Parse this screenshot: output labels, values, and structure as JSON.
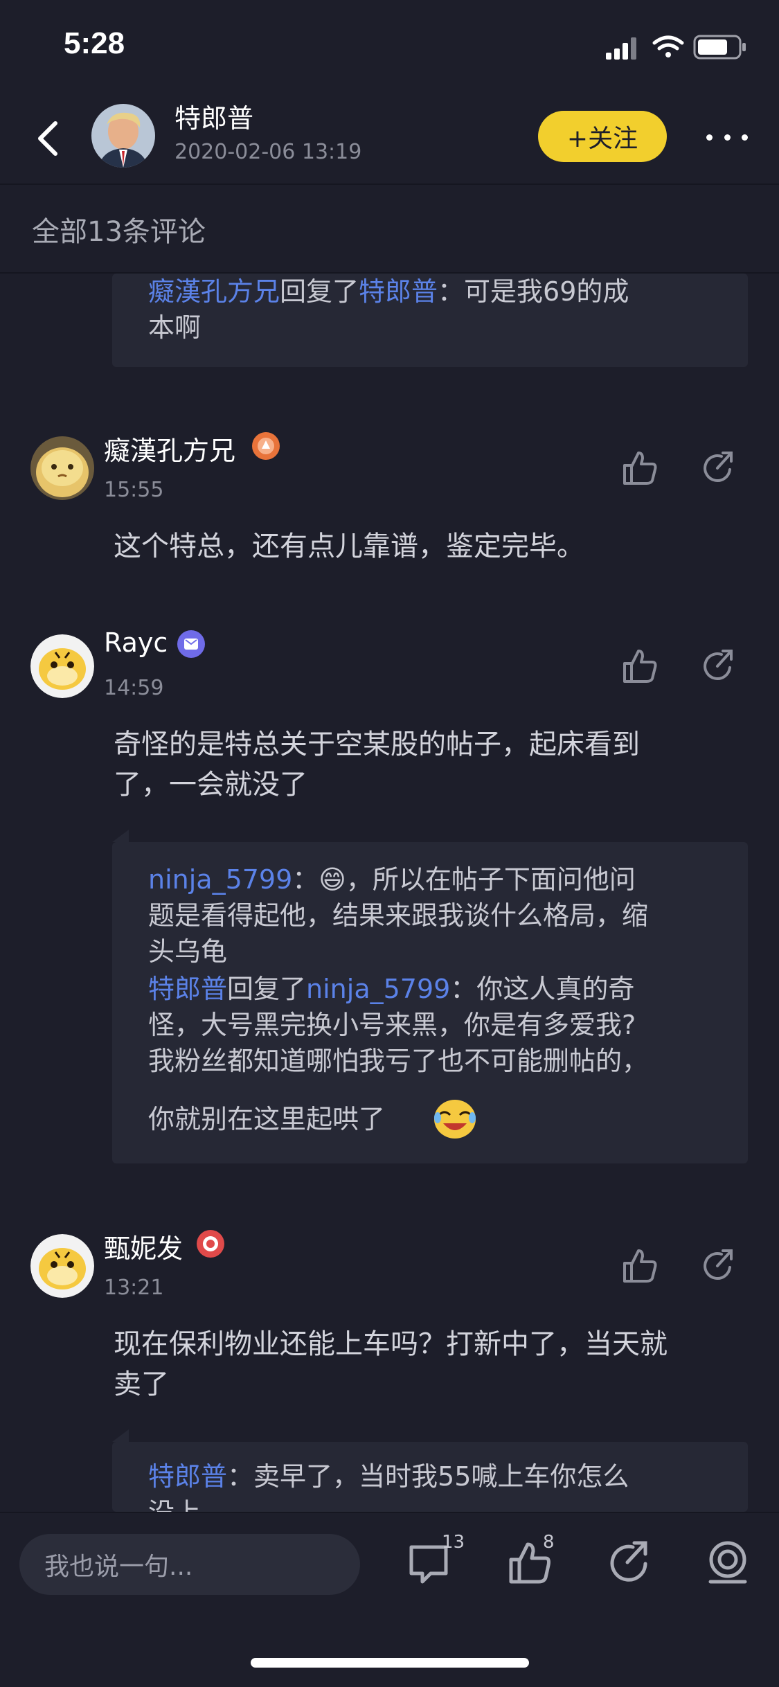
{
  "status_bar": {
    "time": "5:28"
  },
  "header": {
    "author_name": "特郎普",
    "post_time": "2020-02-06 13:19",
    "follow_label": "+关注"
  },
  "comments_count_label": "全部13条评论",
  "top_reply": {
    "user": "癡漢孔方兄",
    "action": "回复了",
    "target": "特郎普",
    "text": "：可是我69的成本啊",
    "line1": "：可是我69的成",
    "line2": "本啊"
  },
  "comments": [
    {
      "user": "癡漢孔方兄",
      "time": "15:55",
      "text": "这个特总，还有点儿靠谱，鉴定完毕。",
      "badge_color": "#e8733a"
    },
    {
      "user": "Rayc",
      "time": "14:59",
      "text_line1": "奇怪的是特总关于空某股的帖子，起床看到",
      "text_line2": "了，一会就没了",
      "badge_color": "#6f6be8",
      "replies": [
        {
          "user": "ninja_5799",
          "text_line1": "：😄，所以在帖子下面问他问",
          "text_line2": "题是看得起他，结果来跟我谈什么格局，缩",
          "text_line3": "头乌龟"
        },
        {
          "user": "特郎普",
          "action": "回复了",
          "target": "ninja_5799",
          "text_line1": "：你这人真的奇",
          "text_line2": "怪，大号黑完换小号来黑，你是有多爱我?",
          "text_line3": "我粉丝都知道哪怕我亏了也不可能删帖的，",
          "text_line4": "你就别在这里起哄了"
        }
      ]
    },
    {
      "user": "甄妮发",
      "time": "13:21",
      "text_line1": "现在保利物业还能上车吗？打新中了，当天就",
      "text_line2": "卖了",
      "badge_color": "#e04a4a",
      "replies": [
        {
          "user": "特郎普",
          "text_line1": "：卖早了，当时我55喊上车你怎么",
          "text_line2": "没上"
        }
      ]
    }
  ],
  "bottom_bar": {
    "input_placeholder": "我也说一句...",
    "comment_count": "13",
    "like_count": "8"
  },
  "colors": {
    "background": "#1d1e2a",
    "reply_box": "#262835",
    "link": "#5b82e8",
    "follow_button": "#f2cf2d"
  },
  "icons": [
    "chevron-left-icon",
    "signal-icon",
    "wifi-icon",
    "battery-icon",
    "more-icon",
    "thumbs-up-icon",
    "share-icon",
    "comment-icon",
    "camera-icon"
  ]
}
